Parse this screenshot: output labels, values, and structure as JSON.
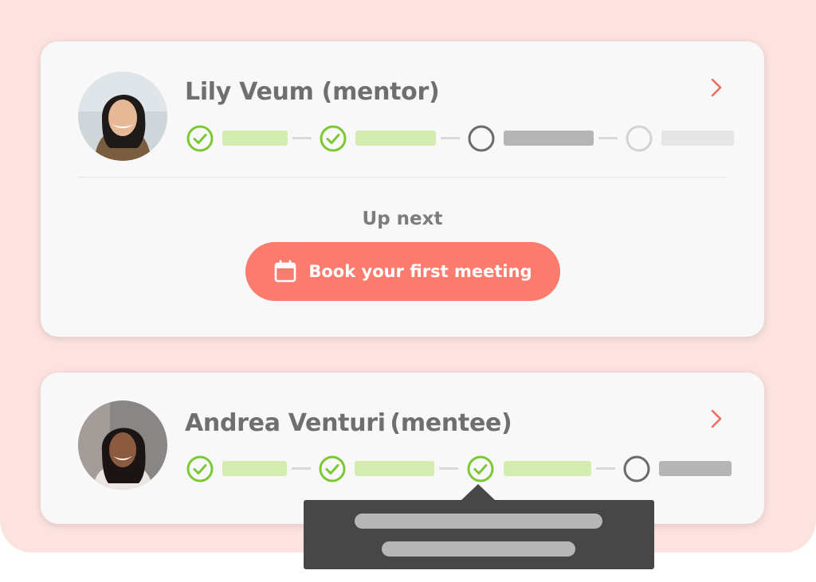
{
  "cards": [
    {
      "name": "Lily Veum (mentor)",
      "steps": [
        "complete",
        "complete",
        "current",
        "pending"
      ],
      "up_next_label": "Up next",
      "action_label": "Book your first meeting",
      "action_icon": "calendar-icon",
      "chevron_icon": "chevron-right-icon"
    },
    {
      "name": "Andrea Venturi (mentee)",
      "steps": [
        "complete",
        "complete",
        "complete",
        "current"
      ],
      "chevron_icon": "chevron-right-icon"
    }
  ],
  "colors": {
    "backdrop": "#fde3e0",
    "card": "#f8f8f8",
    "accent": "#fb7b6f",
    "check": "#7cc734",
    "done_bar": "#d4ecb0",
    "current_bar": "#b5b5b5",
    "tooltip": "#474747"
  }
}
